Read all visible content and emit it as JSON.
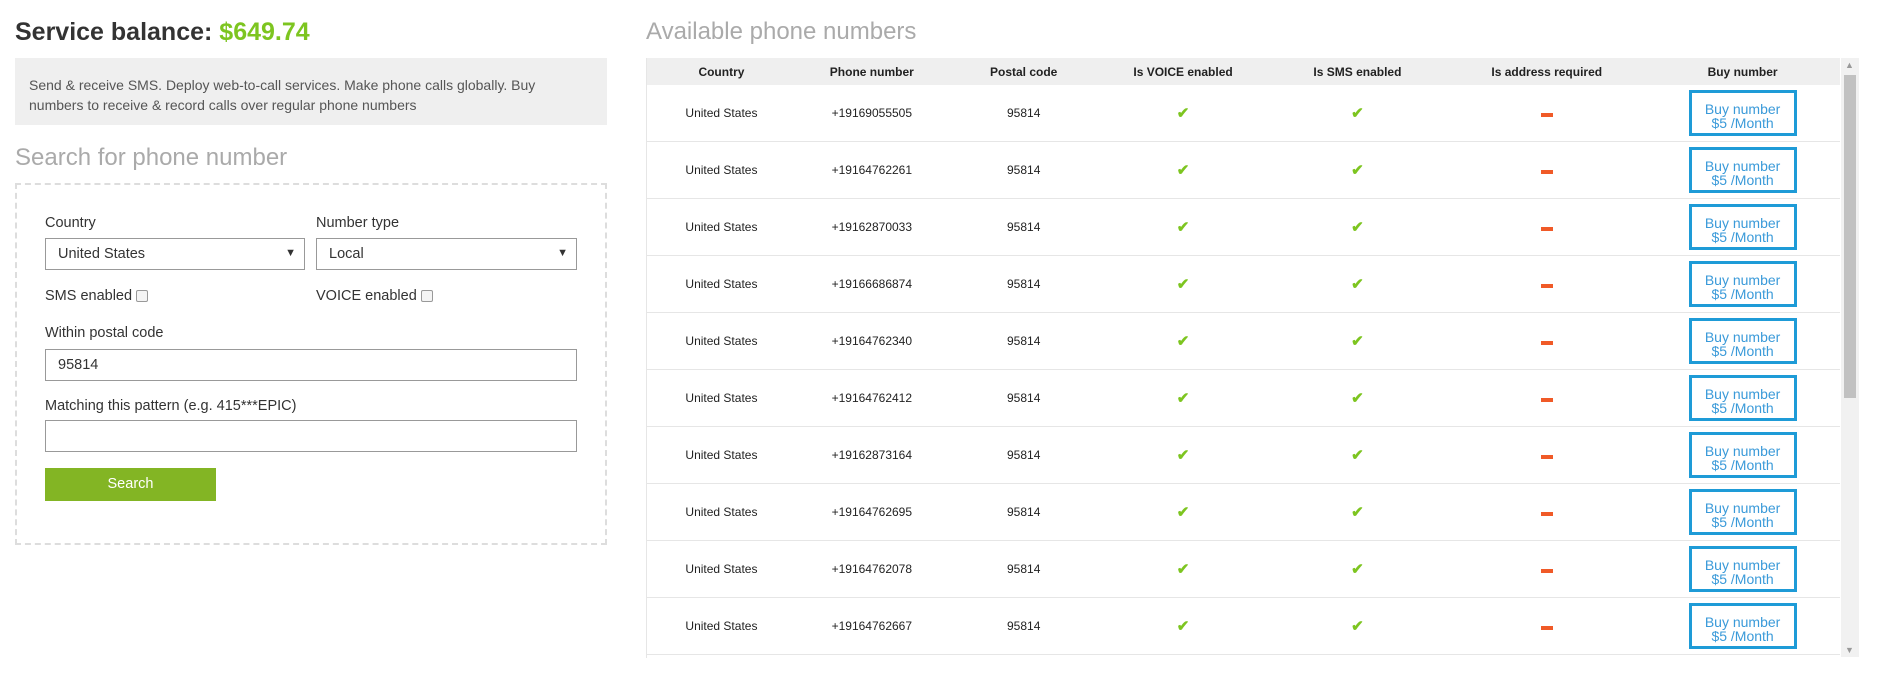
{
  "balance": {
    "label": "Service balance:",
    "amount": "$649.74"
  },
  "description": "Send & receive SMS. Deploy web-to-call services. Make phone calls globally. Buy numbers to receive & record calls over regular phone numbers",
  "search": {
    "heading": "Search for phone number",
    "country_label": "Country",
    "country_value": "United States",
    "type_label": "Number type",
    "type_value": "Local",
    "sms_label": "SMS enabled",
    "sms_checked": false,
    "voice_label": "VOICE enabled",
    "voice_checked": false,
    "postal_label": "Within postal code",
    "postal_value": "95814",
    "pattern_label": "Matching this pattern (e.g. 415***EPIC)",
    "pattern_value": "",
    "button": "Search"
  },
  "available": {
    "heading": "Available phone numbers",
    "columns": [
      "Country",
      "Phone number",
      "Postal code",
      "Is VOICE enabled",
      "Is SMS enabled",
      "Is address required",
      "Buy number"
    ],
    "buy_line1": "Buy number",
    "buy_line2": "$5 /Month",
    "colors": {
      "check": "#7dc520",
      "dash": "#f05a28",
      "button": "#1e9bd7"
    },
    "rows": [
      {
        "country": "United States",
        "phone": "+19169055505",
        "postal": "95814",
        "voice": true,
        "sms": true,
        "address": false
      },
      {
        "country": "United States",
        "phone": "+19164762261",
        "postal": "95814",
        "voice": true,
        "sms": true,
        "address": false
      },
      {
        "country": "United States",
        "phone": "+19162870033",
        "postal": "95814",
        "voice": true,
        "sms": true,
        "address": false
      },
      {
        "country": "United States",
        "phone": "+19166686874",
        "postal": "95814",
        "voice": true,
        "sms": true,
        "address": false
      },
      {
        "country": "United States",
        "phone": "+19164762340",
        "postal": "95814",
        "voice": true,
        "sms": true,
        "address": false
      },
      {
        "country": "United States",
        "phone": "+19164762412",
        "postal": "95814",
        "voice": true,
        "sms": true,
        "address": false
      },
      {
        "country": "United States",
        "phone": "+19162873164",
        "postal": "95814",
        "voice": true,
        "sms": true,
        "address": false
      },
      {
        "country": "United States",
        "phone": "+19164762695",
        "postal": "95814",
        "voice": true,
        "sms": true,
        "address": false
      },
      {
        "country": "United States",
        "phone": "+19164762078",
        "postal": "95814",
        "voice": true,
        "sms": true,
        "address": false
      },
      {
        "country": "United States",
        "phone": "+19164762667",
        "postal": "95814",
        "voice": true,
        "sms": true,
        "address": false
      }
    ]
  }
}
